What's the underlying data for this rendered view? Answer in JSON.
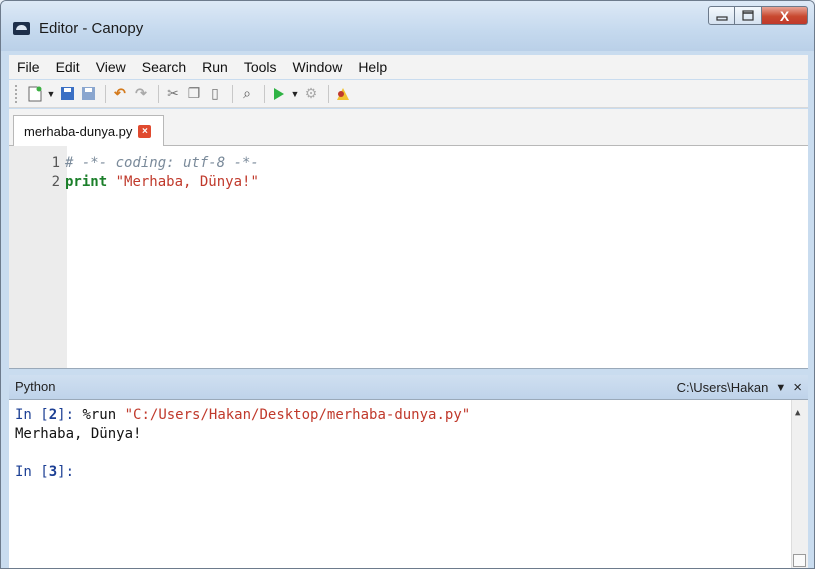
{
  "window": {
    "title": "Editor - Canopy",
    "minimize_icon": "minimize-icon",
    "maximize_icon": "maximize-icon",
    "close_label": "X"
  },
  "menu": [
    "File",
    "Edit",
    "View",
    "Search",
    "Run",
    "Tools",
    "Window",
    "Help"
  ],
  "toolbar": {
    "icons": [
      "new-file-icon",
      "dropdown-arrow-icon",
      "save-icon",
      "save-all-icon",
      "undo-icon",
      "redo-icon",
      "cut-icon",
      "copy-icon",
      "paste-icon",
      "find-icon",
      "run-icon",
      "dropdown-arrow-icon",
      "debug-icon",
      "profile-icon"
    ]
  },
  "tab": {
    "label": "merhaba-dunya.py"
  },
  "editor": {
    "lines": [
      {
        "num": "1",
        "text": "# -*- coding: utf-8 -*-"
      },
      {
        "num": "2",
        "keyword": "print",
        "string": "\"Merhaba, Dünya!\""
      }
    ]
  },
  "console_panel": {
    "title": "Python",
    "path": "C:\\Users\\Hakan",
    "dropdown": "▼",
    "close": "×"
  },
  "console": {
    "line1": {
      "prompt_pre": "In [",
      "num": "2",
      "prompt_post": "]: ",
      "cmd": "%run ",
      "arg": "\"C:/Users/Hakan/Desktop/merhaba-dunya.py\""
    },
    "output": "Merhaba, Dünya!",
    "line3": {
      "prompt_pre": "In [",
      "num": "3",
      "prompt_post": "]: "
    }
  },
  "colors": {
    "keyword": "#1b7f2a",
    "string": "#c0392b",
    "comment": "#7a8a9a",
    "prompt": "#1c3f94"
  }
}
